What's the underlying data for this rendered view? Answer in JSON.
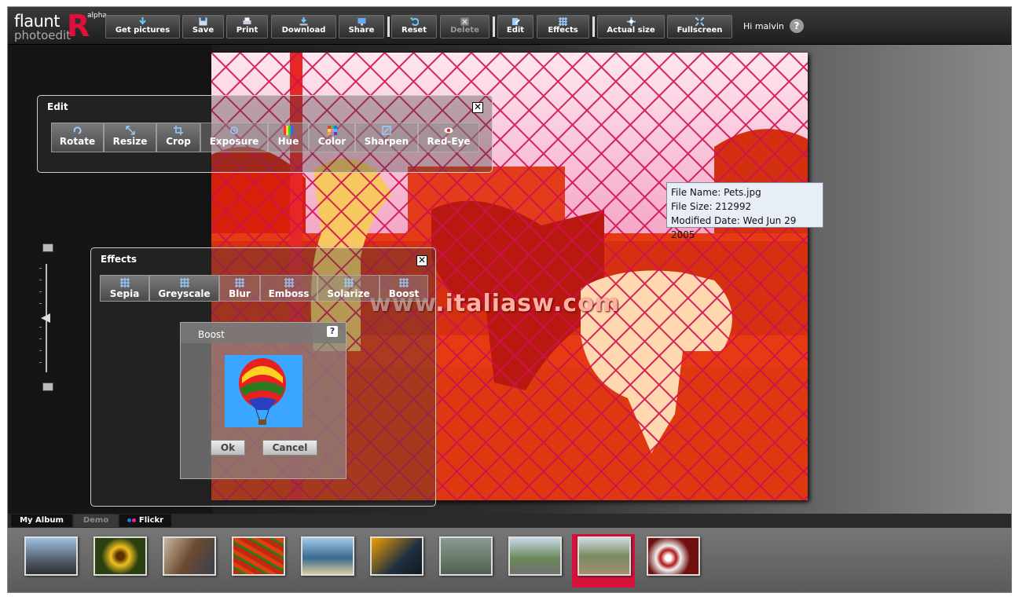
{
  "logo": {
    "name": "flaunt",
    "big_letter": "R",
    "sub": "photoedit",
    "badge": "alpha"
  },
  "toolbar": {
    "buttons": [
      {
        "label": "Get pictures",
        "icon": "download-arrow-icon"
      },
      {
        "label": "Save",
        "icon": "floppy-disk-icon"
      },
      {
        "label": "Print",
        "icon": "printer-icon"
      },
      {
        "label": "Download",
        "icon": "download-tray-icon"
      },
      {
        "label": "Share",
        "icon": "share-monitor-icon"
      },
      {
        "label": "Reset",
        "icon": "undo-icon"
      },
      {
        "label": "Delete",
        "icon": "delete-x-icon",
        "disabled": true
      },
      {
        "label": "Edit",
        "icon": "edit-icon"
      },
      {
        "label": "Effects",
        "icon": "grid-icon"
      },
      {
        "label": "Actual size",
        "icon": "actual-size-icon"
      },
      {
        "label": "Fullscreen",
        "icon": "fullscreen-icon"
      }
    ],
    "greeting": "Hi malvin",
    "help": "?"
  },
  "edit_panel": {
    "title": "Edit",
    "buttons": [
      "Rotate",
      "Resize",
      "Crop",
      "Exposure",
      "Hue",
      "Color",
      "Sharpen",
      "Red-Eye"
    ]
  },
  "effects_panel": {
    "title": "Effects",
    "buttons": [
      "Sepia",
      "Greyscale",
      "Blur",
      "Emboss",
      "Solarize",
      "Boost"
    ]
  },
  "boost_dialog": {
    "title": "Boost",
    "help": "?",
    "ok": "Ok",
    "cancel": "Cancel"
  },
  "file_info": {
    "name": "File Name: Pets.jpg",
    "size": "File Size: 212992",
    "modified": "Modified Date: Wed Jun 29 2005"
  },
  "watermark": "www.italiasw.com",
  "album_tabs": [
    "My Album",
    "Demo",
    "Flickr"
  ],
  "thumbnails": [
    {
      "subject": "highway",
      "color": "#6f8fb0"
    },
    {
      "subject": "sunflower",
      "color": "#b09020"
    },
    {
      "subject": "street",
      "color": "#8a6a50"
    },
    {
      "subject": "chili-peppers",
      "color": "#a02810"
    },
    {
      "subject": "beach",
      "color": "#4a7090"
    },
    {
      "subject": "bird-of-paradise",
      "color": "#d08010"
    },
    {
      "subject": "duck",
      "color": "#708070"
    },
    {
      "subject": "road",
      "color": "#8a9aa0"
    },
    {
      "subject": "dogs",
      "color": "#8a9070",
      "selected": true
    },
    {
      "subject": "car-wheel",
      "color": "#902020"
    }
  ],
  "accent_color": "#d8103c"
}
